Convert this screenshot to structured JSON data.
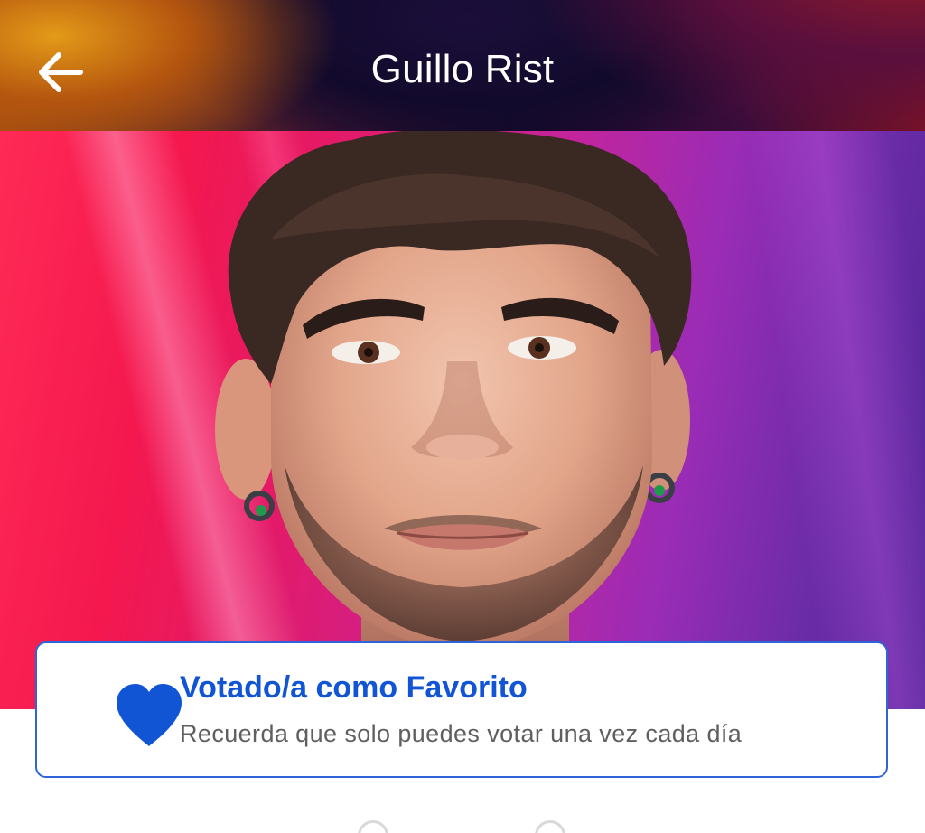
{
  "app_bar": {
    "title": "Guillo Rist",
    "back_icon": "arrow-back-icon"
  },
  "hero": {
    "image_subject": "contestant-portrait",
    "colors": [
      "#ff2a55",
      "#e21a6a",
      "#9a2cb6",
      "#4e2596"
    ]
  },
  "vote_card": {
    "icon": "heart-icon",
    "icon_color": "#1255d4",
    "title": "Votado/a como Favorito",
    "subtitle": "Recuerda que solo puedes votar una vez cada día",
    "border_color": "#2e64d8"
  }
}
